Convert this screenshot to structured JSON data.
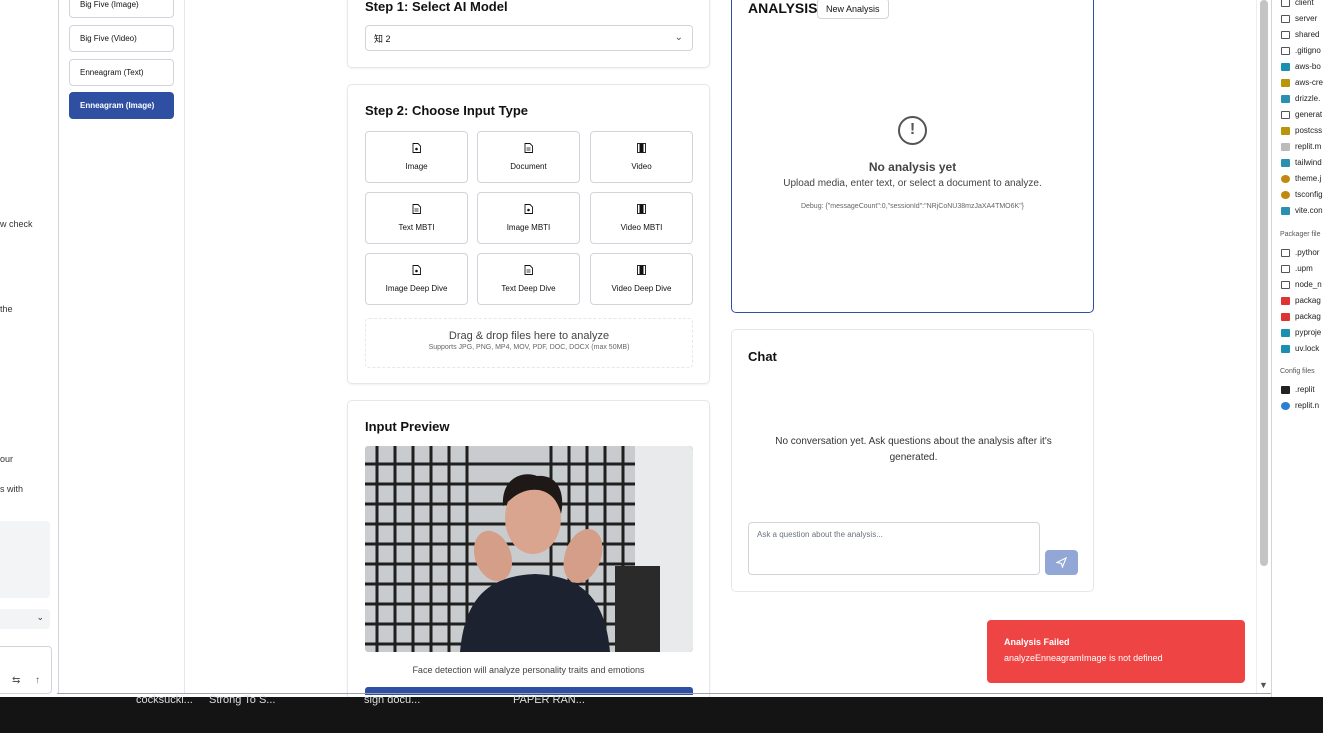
{
  "left_panel": {
    "fragments": [
      "w check",
      "the",
      "our",
      "s with"
    ]
  },
  "sidebar": {
    "items": [
      {
        "label": "Big Five (Image)"
      },
      {
        "label": "Big Five (Video)"
      },
      {
        "label": "Enneagram (Text)"
      },
      {
        "label": "Enneagram (Image)",
        "active": true
      }
    ]
  },
  "step1": {
    "title": "Step 1: Select AI Model",
    "model_value": "知 2"
  },
  "step2": {
    "title": "Step 2: Choose Input Type",
    "tiles": [
      {
        "label": "Image",
        "icon": "image-file-icon"
      },
      {
        "label": "Document",
        "icon": "document-icon"
      },
      {
        "label": "Video",
        "icon": "film-icon"
      },
      {
        "label": "Text MBTI",
        "icon": "document-icon"
      },
      {
        "label": "Image MBTI",
        "icon": "image-file-icon"
      },
      {
        "label": "Video MBTI",
        "icon": "film-icon"
      },
      {
        "label": "Image Deep Dive",
        "icon": "image-file-icon"
      },
      {
        "label": "Text Deep Dive",
        "icon": "document-icon"
      },
      {
        "label": "Video Deep Dive",
        "icon": "film-icon"
      }
    ],
    "dropzone_title": "Drag & drop files here to analyze",
    "dropzone_sub": "Supports JPG, PNG, MP4, MOV, PDF, DOC, DOCX (max 50MB)"
  },
  "preview": {
    "title": "Input Preview",
    "caption": "Face detection will analyze personality traits and emotions"
  },
  "analysis": {
    "title": "ANALYSIS",
    "new_button": "New Analysis",
    "empty_title": "No analysis yet",
    "empty_sub": "Upload media, enter text, or select a document to analyze.",
    "debug": "Debug: {\"messageCount\":0,\"sessionId\":\"NRjCoNU38mzJaXA4TMO6K\"}"
  },
  "chat": {
    "title": "Chat",
    "empty": "No conversation yet. Ask questions about the analysis after it's generated.",
    "placeholder": "Ask a question about the analysis..."
  },
  "toast": {
    "title": "Analysis Failed",
    "message": "analyzeEnneagramImage is not defined",
    "color": "#ef4444"
  },
  "file_tree": {
    "items": [
      {
        "label": "client",
        "icon": "folder-icon"
      },
      {
        "label": "server",
        "icon": "folder-icon"
      },
      {
        "label": "shared",
        "icon": "folder-icon"
      },
      {
        "label": ".gitigno",
        "icon": "file-icon"
      },
      {
        "label": "aws-bo",
        "icon": "python-icon"
      },
      {
        "label": "aws-cre",
        "icon": "js-icon"
      },
      {
        "label": "drizzle.",
        "icon": "ts-icon"
      },
      {
        "label": "generat",
        "icon": "image-icon"
      },
      {
        "label": "postcss",
        "icon": "js-icon"
      },
      {
        "label": "replit.m",
        "icon": "md-icon"
      },
      {
        "label": "tailwind",
        "icon": "ts-icon"
      },
      {
        "label": "theme.j",
        "icon": "json-icon"
      },
      {
        "label": "tsconfig",
        "icon": "json-icon"
      },
      {
        "label": "vite.con",
        "icon": "ts-icon"
      }
    ],
    "packager_header": "Packager file",
    "packager_items": [
      {
        "label": ".pythor",
        "icon": "folder-icon"
      },
      {
        "label": ".upm",
        "icon": "folder-icon"
      },
      {
        "label": "node_n",
        "icon": "folder-icon"
      },
      {
        "label": "packag",
        "icon": "npm-icon"
      },
      {
        "label": "packag",
        "icon": "npm-icon"
      },
      {
        "label": "pyproje",
        "icon": "python-icon"
      },
      {
        "label": "uv.lock",
        "icon": "python-icon"
      }
    ],
    "config_header": "Config files",
    "config_items": [
      {
        "label": ".replit",
        "icon": "replit-icon"
      },
      {
        "label": "replit.n",
        "icon": "gear-icon"
      }
    ]
  },
  "taskbar": {
    "items": [
      "cocksucki...",
      "Strong To S...",
      "sign docu...",
      "PAPER RAN..."
    ]
  }
}
